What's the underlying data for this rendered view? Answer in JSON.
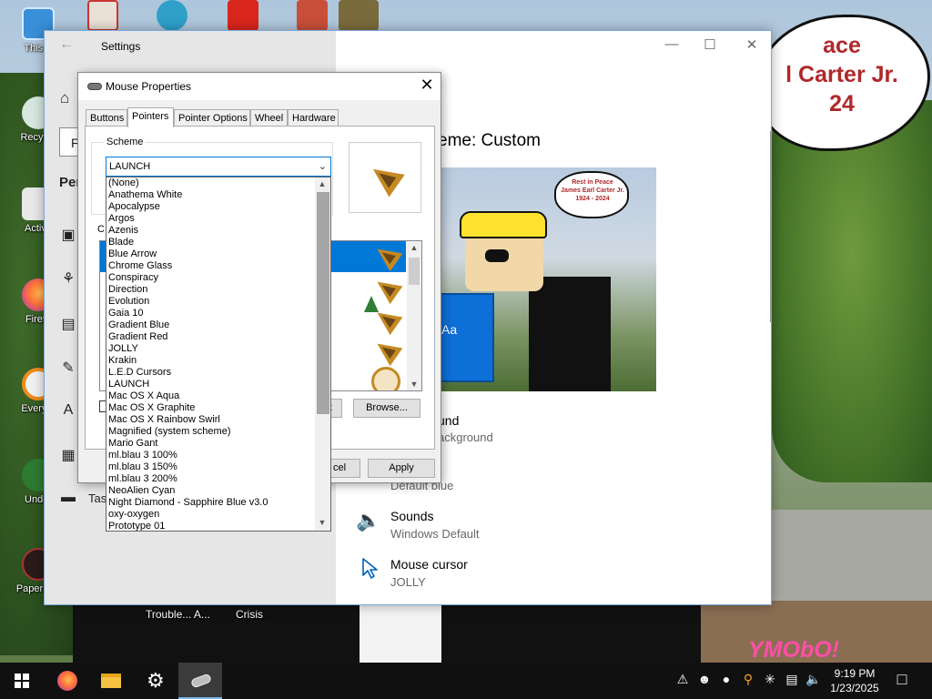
{
  "desktop": {
    "icons": [
      {
        "label": "This P",
        "icon": "computer-icon"
      },
      {
        "label": "Recycle",
        "icon": "recycle-bin-icon"
      },
      {
        "label": "Activa",
        "icon": "activation-icon"
      },
      {
        "label": "Firefo",
        "icon": "firefox-icon"
      },
      {
        "label": "Everyth",
        "icon": "everything-search-icon"
      },
      {
        "label": "Under",
        "icon": "undertale-icon"
      },
      {
        "label": "Papers, P",
        "icon": "papers-please-icon"
      }
    ],
    "bottom_labels": [
      "Trouble... A...",
      "Crisis"
    ],
    "wallpaper_bubble": "Rest in Peace\nJames Earl Carter Jr.\n1924 - 2024",
    "wallpaper_bubble_visible": "ace\nl Carter Jr.\n24",
    "watermark": "YMObO!"
  },
  "settings": {
    "title": "Settings",
    "find_partial": "Fi",
    "section_partial": "Per",
    "taskbar_partial": "Tas",
    "theme_heading_visible": "eme: Custom",
    "preview_bubble": "Rest in Peace\nJames Earl Carter Jr.\n1924 - 2024",
    "preview_tile_text": "Aa",
    "items": [
      {
        "title_visible": "und",
        "subtitle_visible": "ackground"
      },
      {
        "title_visible": "",
        "subtitle_visible": "Default blue"
      },
      {
        "title": "Sounds",
        "subtitle": "Windows Default",
        "icon": "speaker-icon"
      },
      {
        "title": "Mouse cursor",
        "subtitle": "JOLLY",
        "icon": "mouse-cursor-icon"
      }
    ]
  },
  "mouse_properties": {
    "title": "Mouse Properties",
    "tabs": [
      "Buttons",
      "Pointers",
      "Pointer Options",
      "Wheel",
      "Hardware"
    ],
    "active_tab": "Pointers",
    "scheme_label": "Scheme",
    "scheme_value": "LAUNCH",
    "customize_partial": "C",
    "browse_label": "Browse...",
    "use_default_partial": "lt",
    "cancel_partial": "cel",
    "apply_label": "Apply"
  },
  "scheme_dropdown": {
    "options": [
      "(None)",
      "Anathema White",
      "Apocalypse",
      "Argos",
      "Azenis",
      "Blade",
      "Blue Arrow",
      "Chrome Glass",
      "Conspiracy",
      "Direction",
      "Evolution",
      "Gaia 10",
      "Gradient Blue",
      "Gradient Red",
      "JOLLY",
      "Krakin",
      "L.E.D Cursors",
      "LAUNCH",
      "Mac OS X Aqua",
      "Mac OS X Graphite",
      "Mac OS X Rainbow Swirl",
      "Magnified (system scheme)",
      "Mario Gant",
      "ml.blau 3 100%",
      "ml.blau 3 150%",
      "ml.blau 3 200%",
      "NeoAlien Cyan",
      "Night Diamond - Sapphire Blue v3.0",
      "oxy-oxygen",
      "Prototype 01"
    ]
  },
  "taskbar": {
    "pinned": [
      "start-button",
      "firefox-icon",
      "file-explorer-icon",
      "settings-gear-icon",
      "mouse-properties-icon"
    ],
    "time": "9:19 PM",
    "date": "1/23/2025"
  },
  "colors": {
    "accent": "#0078d7",
    "taskbar": "#101010",
    "settings_sidebar": "#e6e6e6",
    "bubble_text": "#b0282a"
  }
}
